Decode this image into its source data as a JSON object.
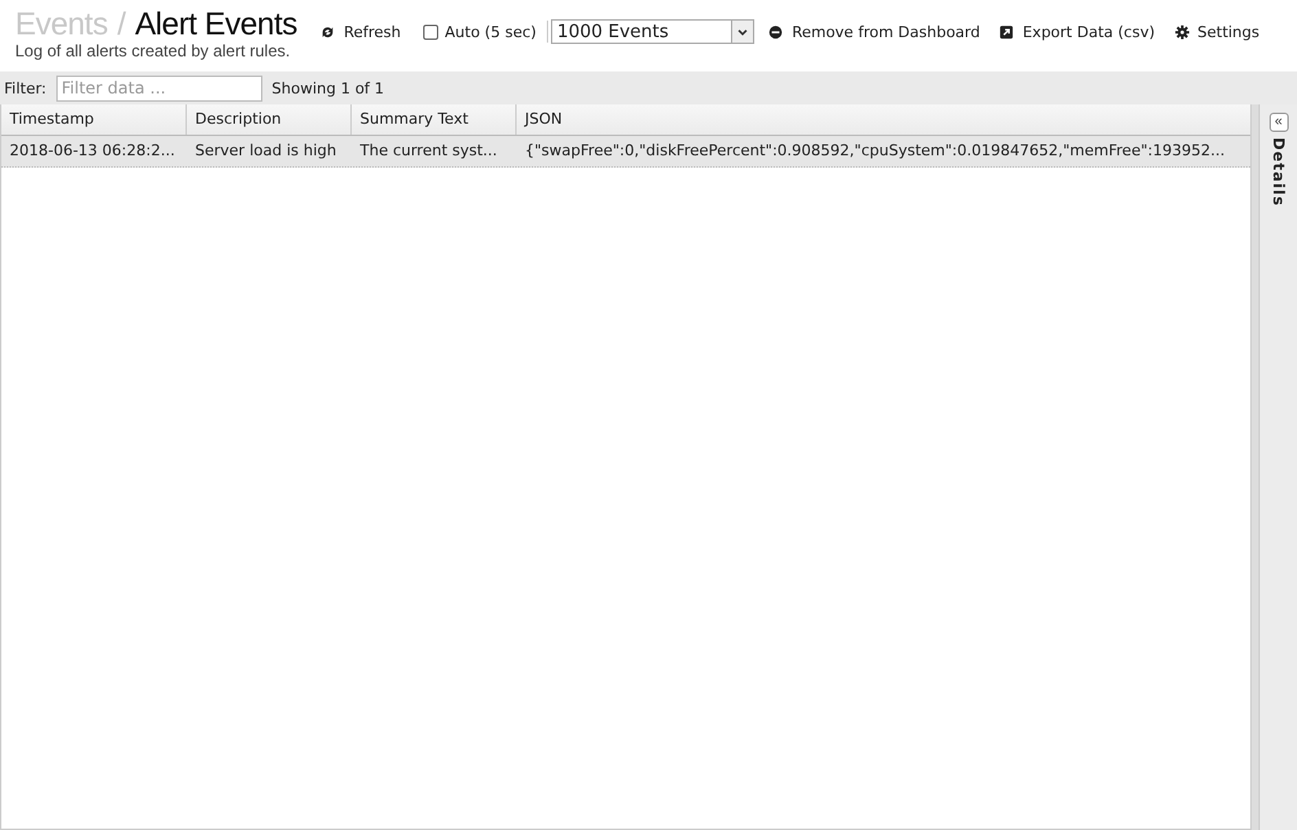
{
  "header": {
    "breadcrumb": "Events",
    "separator": "/",
    "title": "Alert Events",
    "subtitle": "Log of all alerts created by alert rules."
  },
  "toolbar": {
    "refresh": "Refresh",
    "auto": {
      "label": "Auto (5 sec)",
      "checked": false
    },
    "event_limit": "1000 Events",
    "remove": "Remove from Dashboard",
    "export": "Export Data (csv)",
    "settings": "Settings"
  },
  "filter_bar": {
    "label": "Filter:",
    "placeholder": "Filter data ...",
    "count": "Showing 1 of 1"
  },
  "table": {
    "columns": [
      "Timestamp",
      "Description",
      "Summary Text",
      "JSON"
    ],
    "rows": [
      {
        "selected": true,
        "cells": [
          "2018-06-13 06:28:2...",
          "Server load is high",
          "The current syst...",
          "{\"swapFree\":0,\"diskFreePercent\":0.908592,\"cpuSystem\":0.019847652,\"memFree\":193952..."
        ]
      }
    ]
  },
  "details_panel": {
    "label": "Details",
    "expand": "«"
  }
}
